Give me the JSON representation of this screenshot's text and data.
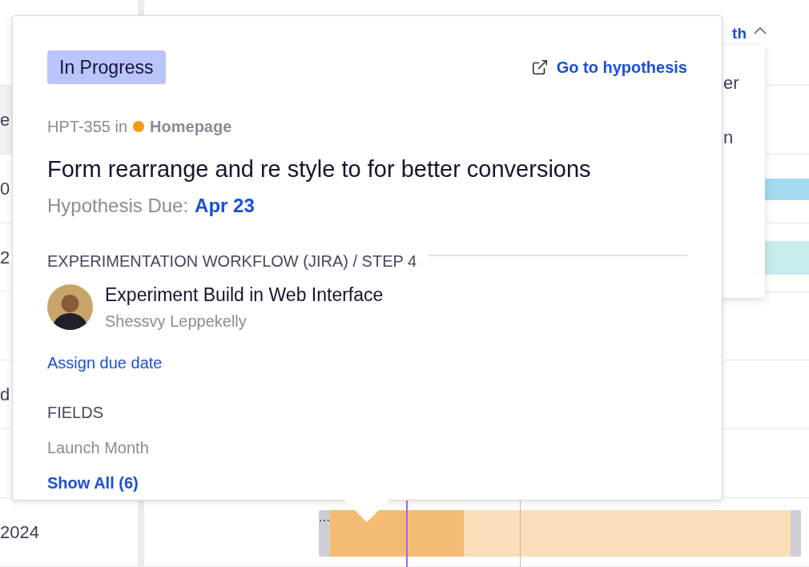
{
  "timeline": {
    "header_link": "th",
    "rows": [
      {
        "label": "e",
        "selected": true
      },
      {
        "label": "0",
        "selected": false
      },
      {
        "label": "2",
        "selected": false
      },
      {
        "selected": false
      },
      {
        "label": "d",
        "selected": false
      },
      {
        "selected": false
      },
      {
        "label": "2024",
        "selected": false
      }
    ],
    "menu_items": [
      "er",
      "n"
    ],
    "bars": [
      {
        "color": "#a3daef"
      },
      {
        "color": "#c6eceb"
      }
    ],
    "gantt_bar": {
      "level": 0.29,
      "handle": "⋯"
    }
  },
  "popover": {
    "status": "In Progress",
    "link": "Go to hypothesis",
    "key": "HPT-355 in",
    "project": {
      "name": "Homepage",
      "color": "#f09a0d"
    },
    "title": "Form rearrange and re style to for better conversions",
    "due_label": "Hypothesis Due:",
    "due_value": "Apr 23",
    "workflow": "EXPERIMENTATION WORKFLOW (JIRA) / STEP 4",
    "step": "Experiment Build in Web Interface",
    "assignee": "Shessvy Leppekelly",
    "assign_link": "Assign due date",
    "fields_label": "FIELDS",
    "fields": [
      "Launch Month"
    ],
    "show_all": "Show All (6)"
  }
}
